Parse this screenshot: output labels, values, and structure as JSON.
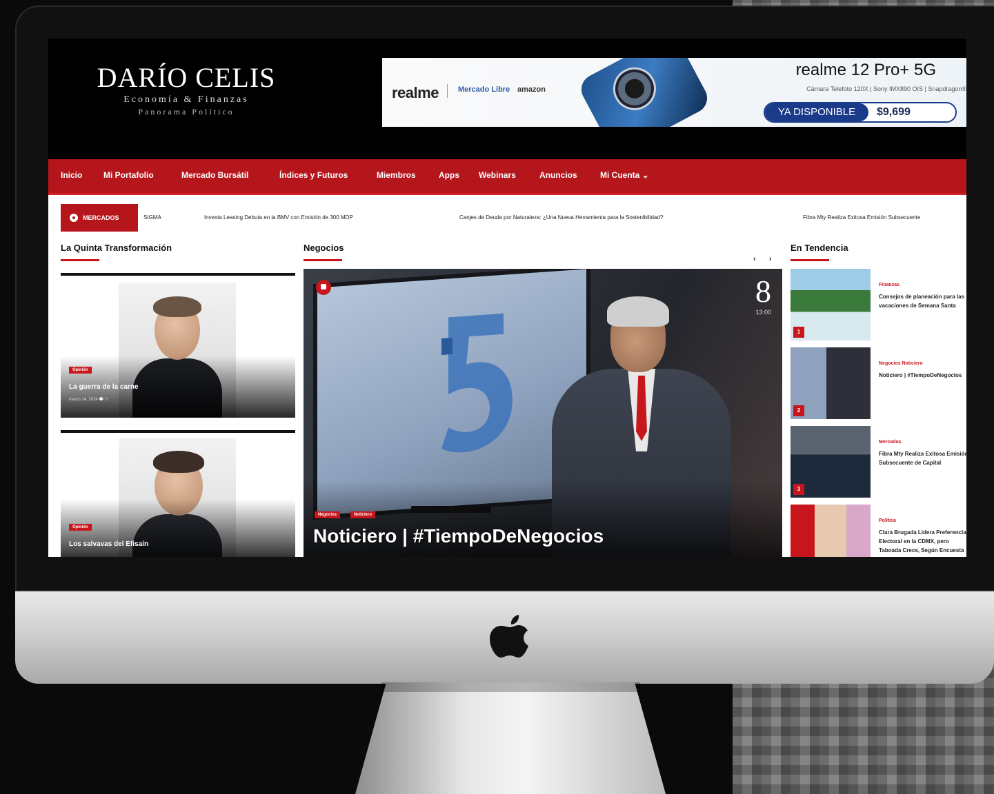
{
  "site": {
    "logo_title": "DARÍO CELIS",
    "logo_sub1": "Economía & Finanzas",
    "logo_sub2": "Panorama Político"
  },
  "ad": {
    "brand": "realme",
    "partner1": "Mercado Libre",
    "partner2": "amazon",
    "model": "realme 12 Pro+ 5G",
    "specs": "Cámara Telefoto 120X  |  Sony IMX890 OIS  |  Snapdragon®",
    "cta": "YA DISPONIBLE",
    "price": "$9,699"
  },
  "nav": {
    "items": [
      "Inicio",
      "Mi Portafolio",
      "Mercado Bursátil",
      "Índices y Futuros",
      "Miembros",
      "Apps",
      "Webinars",
      "Anuncios",
      "Mi Cuenta ⌄"
    ]
  },
  "ticker": {
    "badge": "MERCADOS",
    "items": [
      "SIGMA",
      "Invexta Leasing Debuta en la BMV con Emisión de 300 MDP",
      "Canjes de Deuda por Naturaleza: ¿Una Nueva Herramienta para la Sostenibilidad?",
      "Fibra Mty Realiza Exitosa Emisión Subsecuente"
    ]
  },
  "sections": {
    "left_title": "La Quinta Transformación",
    "center_title": "Negocios",
    "right_title": "En Tendencia"
  },
  "opinion_cards": [
    {
      "tag": "Opinión",
      "title": "La guerra de la carne",
      "meta": "marzo 14, 2024  💬 0"
    },
    {
      "tag": "Opinión",
      "title": "Los salvavas del Efisaín",
      "meta": ""
    }
  ],
  "hero": {
    "tags": [
      "Negocios",
      "Noticiero"
    ],
    "title": "Noticiero | #TiempoDeNegocios",
    "channel_num": "8",
    "channel_time": "13:00"
  },
  "carousel": {
    "arrows": "‹ ›"
  },
  "trending": [
    {
      "num": "1",
      "cat": "Finanzas",
      "text": "Consejos de planeación para las vacaciones de Semana Santa"
    },
    {
      "num": "2",
      "cat": "Negocios  Noticiero",
      "text": "Noticiero | #TiempoDeNegocios"
    },
    {
      "num": "3",
      "cat": "Mercados",
      "text": "Fibra Mty Realiza Exitosa Emisión Subsecuente de Capital"
    },
    {
      "num": "4",
      "cat": "Política",
      "text": "Clara Brugada Lidera Preferencia Electoral en la CDMX, pero Taboada Crece, Según Encuesta"
    }
  ],
  "colors": {
    "brand_red": "#b5161c",
    "accent_red": "#c8161d",
    "header_bg": "#000000"
  }
}
